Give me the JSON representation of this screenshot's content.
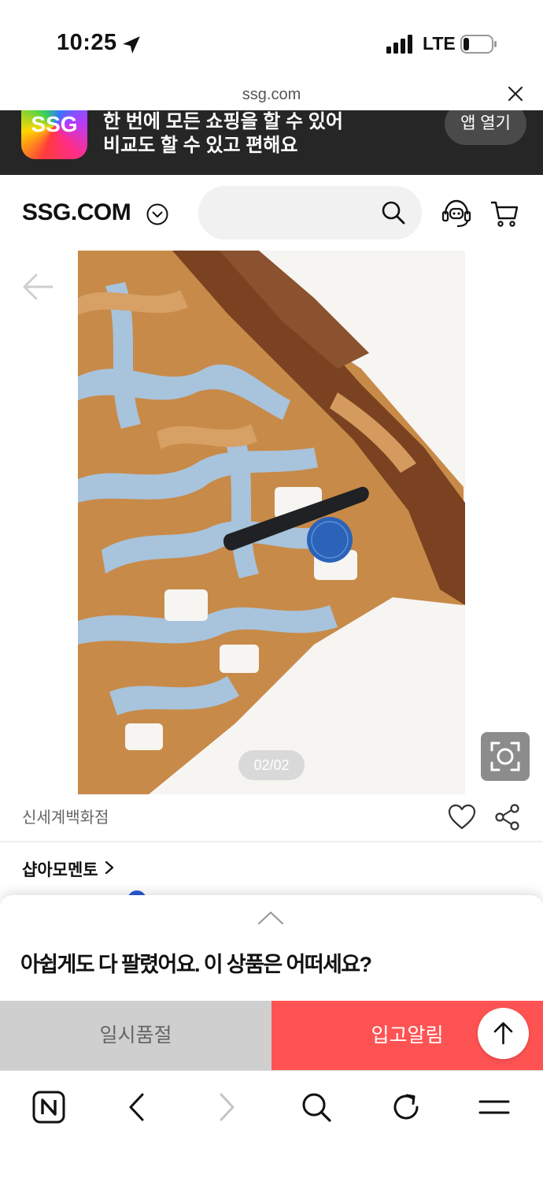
{
  "status": {
    "time": "10:25",
    "network": "LTE"
  },
  "url_bar": {
    "domain": "ssg.com"
  },
  "banner": {
    "logo_text": "SSG",
    "line1": "한 번에 모든 쇼핑을 할 수 있어",
    "line2": "비교도 할 수 있고 편해요",
    "open_label": "앱 열기"
  },
  "header": {
    "brand": "SSG.COM"
  },
  "product": {
    "image_counter": "02/02",
    "seller": "신세계백화점",
    "shop_name": "샵아모멘토"
  },
  "sheet": {
    "message": "아쉽게도 다 팔렸어요. 이 상품은 어떠세요?",
    "soldout_label": "일시품절",
    "notify_label": "입고알림"
  },
  "icons": [
    "location-icon",
    "signal-icon",
    "battery-icon",
    "close-icon",
    "chevron-down-icon",
    "search-icon",
    "customer-service-icon",
    "cart-icon",
    "back-arrow-icon",
    "lens-search-icon",
    "heart-icon",
    "share-icon",
    "chevron-right-icon",
    "chevron-up-icon",
    "arrow-up-icon",
    "naver-n-icon",
    "back-icon",
    "forward-icon",
    "reload-icon",
    "menu-icon"
  ],
  "colors": {
    "banner_bg": "#262626",
    "notify_bg": "#ff5353",
    "soldout_bg": "#cfcfcf"
  }
}
